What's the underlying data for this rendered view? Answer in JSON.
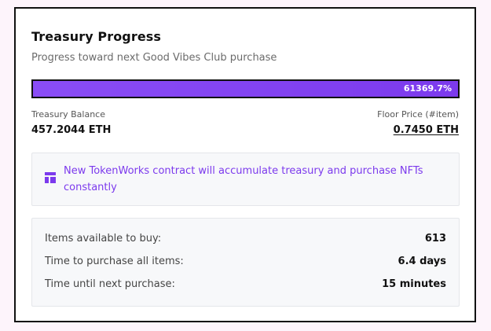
{
  "card": {
    "title": "Treasury Progress",
    "subtitle": "Progress toward next Good Vibes Club purchase"
  },
  "progress": {
    "label": "61369.7%",
    "fill_fraction": 1.0,
    "color": "#7c3aed"
  },
  "treasury": {
    "label": "Treasury Balance",
    "value": "457.2044 ETH"
  },
  "floor": {
    "label": "Floor Price (#item)",
    "value": "0.7450 ETH"
  },
  "info": {
    "icon": "layout-icon",
    "text": "New TokenWorks contract will accumulate treasury and purchase NFTs constantly"
  },
  "stats": [
    {
      "label": "Items available to buy:",
      "value": "613"
    },
    {
      "label": "Time to purchase all items:",
      "value": "6.4 days"
    },
    {
      "label": "Time until next purchase:",
      "value": "15 minutes"
    }
  ],
  "colors": {
    "accent": "#7c3aed",
    "background": "#fdf4fb",
    "border": "#111111"
  }
}
